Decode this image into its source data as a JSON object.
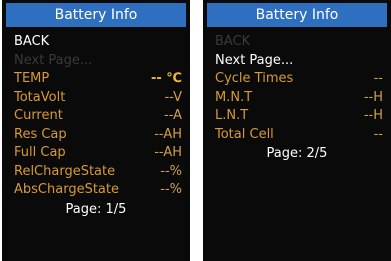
{
  "screens": [
    {
      "title": "Battery Info",
      "back": "BACK",
      "next": "Next Page...",
      "items": [
        {
          "label": "TEMP",
          "value": "-- ℃"
        },
        {
          "label": "TotaVolt",
          "value": "--V"
        },
        {
          "label": "Current",
          "value": "--A"
        },
        {
          "label": "Res Cap",
          "value": "--AH"
        },
        {
          "label": "Full Cap",
          "value": "--AH"
        },
        {
          "label": "RelChargeState",
          "value": "--%"
        },
        {
          "label": "AbsChargeState",
          "value": "--%"
        }
      ],
      "page": "Page: 1/5"
    },
    {
      "title": "Battery Info",
      "back": "BACK",
      "next": "Next Page...",
      "items": [
        {
          "label": "Cycle Times",
          "value": "--"
        },
        {
          "label": "M.N.T",
          "value": "--H"
        },
        {
          "label": "L.N.T",
          "value": "--H"
        },
        {
          "label": "Total Cell",
          "value": "--"
        }
      ],
      "page": "Page: 2/5"
    }
  ],
  "colors": {
    "title_bar": "#2f6fc0",
    "background": "#0a0a0a",
    "label_orange": "#d99a34",
    "text_white": "#ffffff",
    "disabled": "#3a3a3a"
  }
}
